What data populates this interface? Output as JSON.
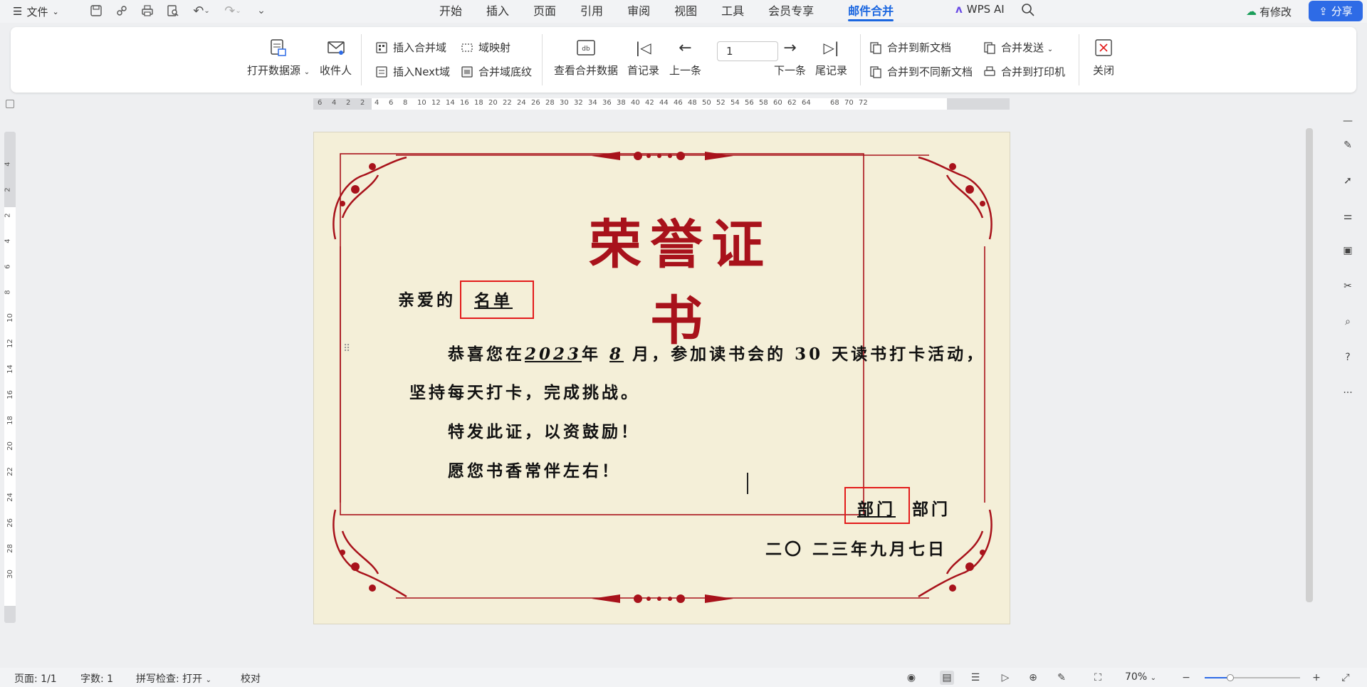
{
  "topbar": {
    "file_label": "文件",
    "tabs": [
      "开始",
      "插入",
      "页面",
      "引用",
      "审阅",
      "视图",
      "工具",
      "会员专享",
      "邮件合并"
    ],
    "active_tab": "邮件合并",
    "wps_ai": "WPS AI",
    "modify_label": "有修改",
    "share_label": "分享"
  },
  "ribbon": {
    "open_datasource": "打开数据源",
    "recipients": "收件人",
    "insert_merge_field": "插入合并域",
    "field_mapping": "域映射",
    "insert_next_field": "插入Next域",
    "merge_field_shading": "合并域底纹",
    "view_merged_data": "查看合并数据",
    "first_record": "首记录",
    "prev_record": "上一条",
    "record_number": "1",
    "next_record": "下一条",
    "last_record": "尾记录",
    "merge_new_doc": "合并到新文档",
    "merge_diff_docs": "合并到不同新文档",
    "merge_send": "合并发送",
    "merge_printer": "合并到打印机",
    "close": "关闭"
  },
  "ruler": {
    "h_ticks": [
      "6",
      "4",
      "2",
      "2",
      "4",
      "6",
      "8",
      "10",
      "12",
      "14",
      "16",
      "18",
      "20",
      "22",
      "24",
      "26",
      "28",
      "30",
      "32",
      "34",
      "36",
      "38",
      "40",
      "42",
      "44",
      "46",
      "48",
      "50",
      "52",
      "54",
      "56",
      "58",
      "60",
      "62",
      "64",
      "68",
      "70",
      "72"
    ],
    "v_ticks": [
      "4",
      "2",
      "2",
      "4",
      "6",
      "8",
      "10",
      "12",
      "14",
      "16",
      "18",
      "20",
      "22",
      "24",
      "26",
      "28",
      "30"
    ]
  },
  "certificate": {
    "title": "荣誉证书",
    "greeting_prefix": "亲爱的",
    "name_field": "名单",
    "body_line1_a": "恭喜您在",
    "year": "2023",
    "body_line1_b": "年",
    "month": "8",
    "body_line1_c": "月，参加读书会的 30 天读书打卡活动，",
    "body_line2": "坚持每天打卡，完成挑战。",
    "body_line3": "特发此证，以资鼓励！",
    "body_line4": "愿您书香常伴左右！",
    "dept_field": "部门",
    "dept_suffix": "部门",
    "date": "二〇 二三年九月七日"
  },
  "statusbar": {
    "page": "页面: 1/1",
    "word_count": "字数: 1",
    "spellcheck": "拼写检查: 打开",
    "proofread": "校对",
    "zoom": "70%",
    "zoom_fraction": 0.27
  },
  "colors": {
    "accent": "#1a66e0",
    "share_bg": "#2e6be6",
    "cert_red": "#a8121b",
    "page_bg": "#f4efd8",
    "merge_box": "#e31b1b"
  }
}
